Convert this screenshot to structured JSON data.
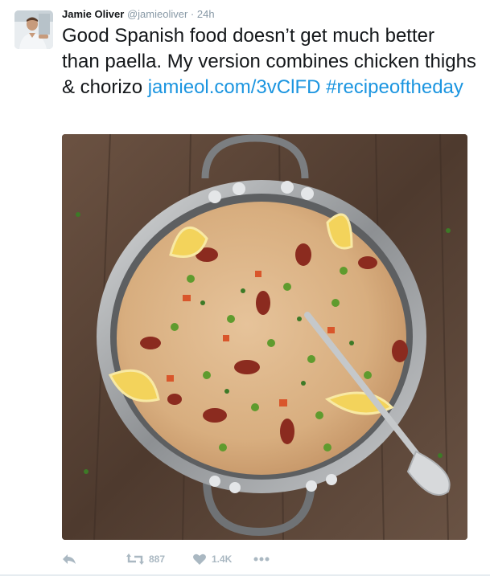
{
  "tweet": {
    "author_name": "Jamie Oliver",
    "author_handle": "@jamieoliver",
    "separator": "·",
    "timestamp": "24h",
    "text_plain": "Good Spanish food doesn’t get much better than paella. My version combines chicken thighs & chorizo ",
    "link": "jamieol.com/3vClFD",
    "hashtag": "#recipeoftheday",
    "photo_icon": "paella-pan-photo",
    "avatar_icon": "profile-photo",
    "colors": {
      "link": "#1b95e0",
      "text": "#14171a",
      "muted": "#8899a6",
      "action_icon": "#aab8c2"
    }
  },
  "actions": {
    "reply_icon": "reply-icon",
    "retweet_icon": "retweet-icon",
    "retweet_count": "887",
    "like_icon": "heart-icon",
    "like_count": "1.4K",
    "more_icon": "more-icon"
  }
}
